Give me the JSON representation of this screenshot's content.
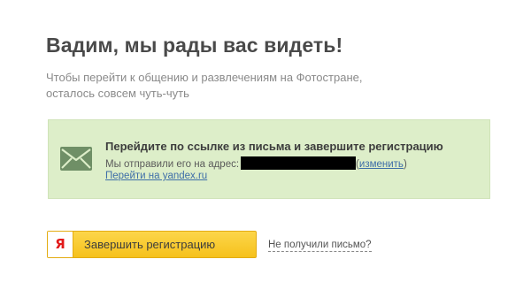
{
  "header": {
    "title": "Вадим, мы рады вас видеть!",
    "subtitle_line1": "Чтобы перейти к общению и развлечениям на Фотостране,",
    "subtitle_line2": "осталось совсем чуть-чуть"
  },
  "notice": {
    "icon": "envelope-icon",
    "heading": "Перейдите по ссылке из письма и завершите регистрацию",
    "sent_text": "Мы отправили его на адрес:",
    "change_open": "(",
    "change_link": "изменить",
    "change_close": ")",
    "mail_link": "Перейти на yandex.ru"
  },
  "actions": {
    "finish_button_label": "Завершить регистрацию",
    "finish_button_icon_letter": "Я",
    "no_email_link": "Не получили письмо?"
  },
  "colors": {
    "notice_bg": "#ddeec9",
    "button_bg": "#f6c11c",
    "link": "#3e6ea8",
    "yandex_red": "#e21a1a"
  }
}
